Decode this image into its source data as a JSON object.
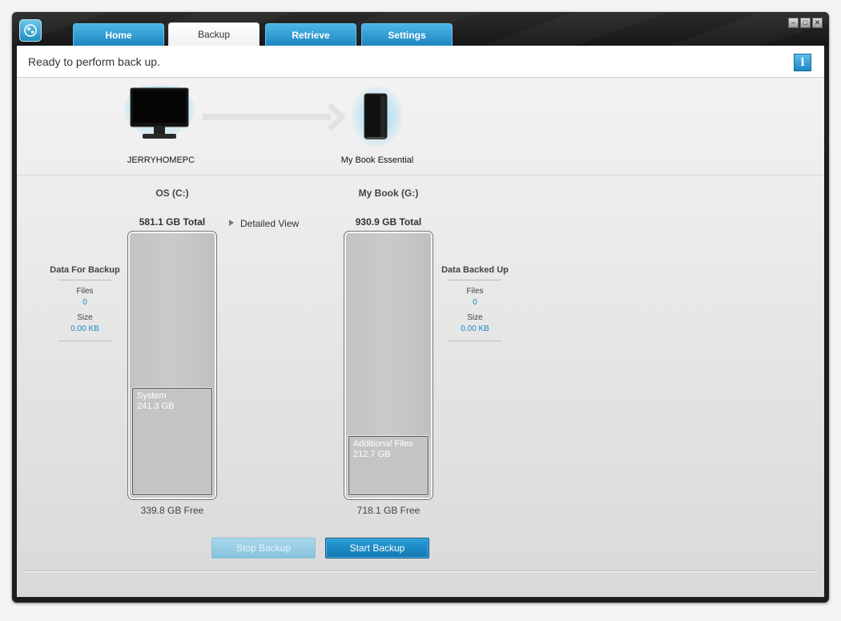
{
  "tabs": [
    {
      "label": "Home"
    },
    {
      "label": "Backup"
    },
    {
      "label": "Retrieve"
    },
    {
      "label": "Settings"
    }
  ],
  "window_buttons": {
    "minimize": "–",
    "restore": "□",
    "close": "✕"
  },
  "status": {
    "text": "Ready to perform back up.",
    "info_label": "i"
  },
  "source_device": {
    "name": "JERRYHOMEPC",
    "icon": "monitor-icon"
  },
  "target_device": {
    "name": "My Book Essential",
    "icon": "external-drive-icon"
  },
  "source_drive": {
    "title": "OS (C:)",
    "total": "581.1 GB Total",
    "free": "339.8 GB Free",
    "segment": {
      "name": "System",
      "size": "241.3 GB"
    }
  },
  "target_drive": {
    "title": "My Book (G:)",
    "total": "930.9 GB Total",
    "free": "718.1 GB Free",
    "segment": {
      "name": "Additional Files",
      "size": "212.7 GB"
    }
  },
  "detailed_view_label": "Detailed View",
  "data_for_backup": {
    "heading": "Data For Backup",
    "files_label": "Files",
    "files_value": "0",
    "size_label": "Size",
    "size_value": "0.00 KB"
  },
  "data_backed_up": {
    "heading": "Data Backed Up",
    "files_label": "Files",
    "files_value": "0",
    "size_label": "Size",
    "size_value": "0.00 KB"
  },
  "buttons": {
    "stop_backup": "Stop Backup",
    "start_backup": "Start Backup"
  },
  "colors": {
    "accent": "#1b8ac8",
    "tab_blue": "#2a9fd8"
  }
}
